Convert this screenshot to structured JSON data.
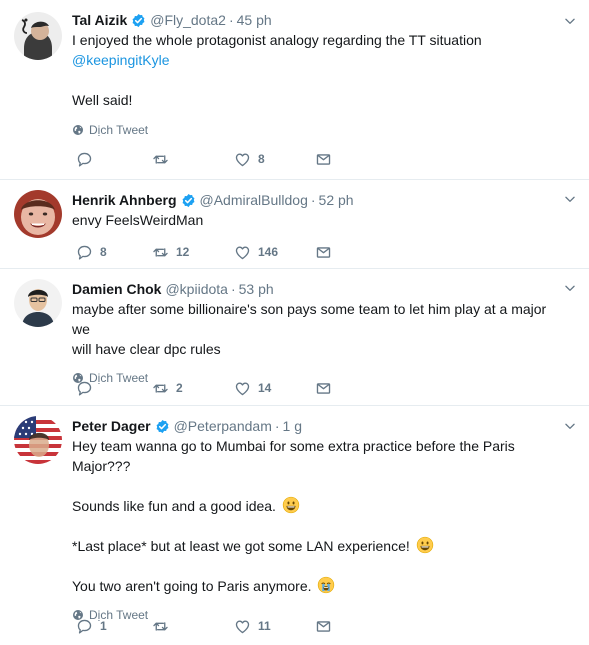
{
  "tweets": [
    {
      "name": "Tal Aizik",
      "handle": "@Fly_dota2",
      "time": "45 ph",
      "line1": "I enjoyed the whole protagonist analogy regarding the TT situation",
      "mention": "@keepingitKyle",
      "line2": "Well said!",
      "translate": "Dịch Tweet",
      "likes": "8",
      "icons": {
        "avatar": "avatar-photo",
        "verified": "verified-badge-icon"
      }
    },
    {
      "name": "Henrik Ahnberg",
      "handle": "@AdmiralBulldog",
      "time": "52 ph",
      "line1": "envy FeelsWeirdMan",
      "replies": "8",
      "retweets": "12",
      "likes": "146"
    },
    {
      "name": "Damien Chok",
      "handle": "@kpiidota",
      "time": "53 ph",
      "line1": "maybe after some billionaire's son pays some team to let him play at a major we",
      "line2": "will have clear dpc rules",
      "translate": "Dịch Tweet",
      "retweets": "2",
      "likes": "14"
    },
    {
      "name": "Peter Dager",
      "handle": "@Peterpandam",
      "time": "1 g",
      "line1": "Hey team wanna go to Mumbai for some extra practice before the Paris Major???",
      "line2": "Sounds like fun and a good idea.",
      "line3": "*Last place* but at least we got some LAN experience!",
      "line4": "You two aren't going to Paris anymore.",
      "translate": "Dịch Tweet",
      "replies": "1",
      "likes": "11"
    }
  ],
  "colors": {
    "text": "#14171a",
    "muted": "#657786",
    "link": "#1b95e0",
    "verified": "#1da1f2",
    "border": "#e6ecf0"
  }
}
